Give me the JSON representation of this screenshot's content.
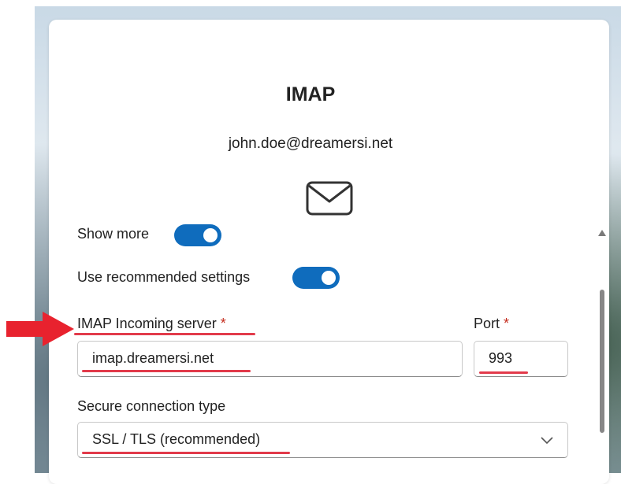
{
  "dialog": {
    "title": "IMAP",
    "email": "john.doe@dreamersi.net"
  },
  "icons": {
    "mail": "envelope-icon",
    "arrow": "red-arrow-icon",
    "dropdown": "chevron-down-icon",
    "scroll": "scroll-up-arrow-icon"
  },
  "show_more": {
    "label": "Show more",
    "on": true
  },
  "recommended": {
    "label": "Use recommended settings",
    "on": true
  },
  "incoming_server": {
    "label": "IMAP Incoming server",
    "required_mark": "*",
    "value": "imap.dreamersi.net"
  },
  "port": {
    "label": "Port",
    "required_mark": "*",
    "value": "993"
  },
  "secure_connection": {
    "label": "Secure connection type",
    "selected": "SSL / TLS (recommended)"
  },
  "colors": {
    "accent": "#0f6cbd",
    "annotation_red": "#e23b4b",
    "required": "#c42b1c"
  }
}
